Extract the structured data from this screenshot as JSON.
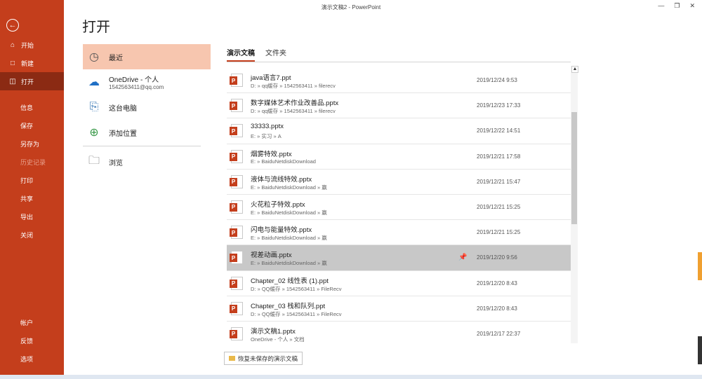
{
  "window": {
    "title": "演示文稿2 - PowerPoint"
  },
  "sidebar": {
    "back_icon": "back-arrow-icon",
    "top_items": [
      {
        "label": "开始",
        "icon": "home-icon"
      },
      {
        "label": "新建",
        "icon": "new-document-icon"
      },
      {
        "label": "打开",
        "icon": "open-folder-icon",
        "active": true
      }
    ],
    "mid_items": [
      {
        "label": "信息"
      },
      {
        "label": "保存"
      },
      {
        "label": "另存为"
      },
      {
        "label": "历史记录",
        "disabled": true
      },
      {
        "label": "打印"
      },
      {
        "label": "共享"
      },
      {
        "label": "导出"
      },
      {
        "label": "关闭"
      }
    ],
    "bottom_items": [
      {
        "label": "帐户"
      },
      {
        "label": "反馈"
      },
      {
        "label": "选项"
      }
    ]
  },
  "page_title": "打开",
  "locations": [
    {
      "label": "最近",
      "icon": "clock-icon",
      "selected": true
    },
    {
      "label": "OneDrive - 个人",
      "sub": "1542563411@qq.com",
      "icon": "onedrive-cloud-icon"
    },
    {
      "label": "这台电脑",
      "icon": "computer-icon"
    },
    {
      "label": "添加位置",
      "icon": "add-location-globe-icon"
    },
    {
      "label": "浏览",
      "icon": "folder-icon"
    }
  ],
  "tabs": [
    {
      "label": "演示文稿",
      "active": true
    },
    {
      "label": "文件夹"
    }
  ],
  "files": [
    {
      "name": "java语言7.ppt",
      "path": "D: » qq缓存 » 1542563411 » filerecv",
      "date": "2019/12/24 9:53"
    },
    {
      "name": "数字媒体艺术作业改善品.pptx",
      "path": "D: » qq缓存 » 1542563411 » filerecv",
      "date": "2019/12/23 17:33"
    },
    {
      "name": "33333.pptx",
      "path": "E: » 实习 » A",
      "date": "2019/12/22 14:51"
    },
    {
      "name": "烟雾特效.pptx",
      "path": "E: » BaiduNetdiskDownload",
      "date": "2019/12/21 17:58"
    },
    {
      "name": "液体与流线特效.pptx",
      "path": "E: » BaiduNetdiskDownload » 赢",
      "date": "2019/12/21 15:47"
    },
    {
      "name": "火花粒子特效.pptx",
      "path": "E: » BaiduNetdiskDownload » 赢",
      "date": "2019/12/21 15:25"
    },
    {
      "name": "闪电与能量特效.pptx",
      "path": "E: » BaiduNetdiskDownload » 赢",
      "date": "2019/12/21 15:25"
    },
    {
      "name": "视差动画.pptx",
      "path": "E: » BaiduNetdiskDownload » 赢",
      "date": "2019/12/20 9:56",
      "highlighted": true
    },
    {
      "name": "Chapter_02 线性表 (1).ppt",
      "path": "D: » QQ缓存 » 1542563411 » FileRecv",
      "date": "2019/12/20 8:43"
    },
    {
      "name": "Chapter_03 栈和队列.ppt",
      "path": "D: » QQ缓存 » 1542563411 » FileRecv",
      "date": "2019/12/20 8:43"
    },
    {
      "name": "演示文稿1.pptx",
      "path": "OneDrive - 个人 » 文档",
      "date": "2019/12/17 22:37"
    }
  ],
  "file_icon_letter": "P",
  "pin_icon": "pin-icon",
  "recover_button": "恢复未保存的演示文稿",
  "colors": {
    "accent": "#c43e1c",
    "active_nav": "#8b2a13",
    "selected_location": "#f7c6af",
    "highlighted_row": "#c8c8c8"
  }
}
